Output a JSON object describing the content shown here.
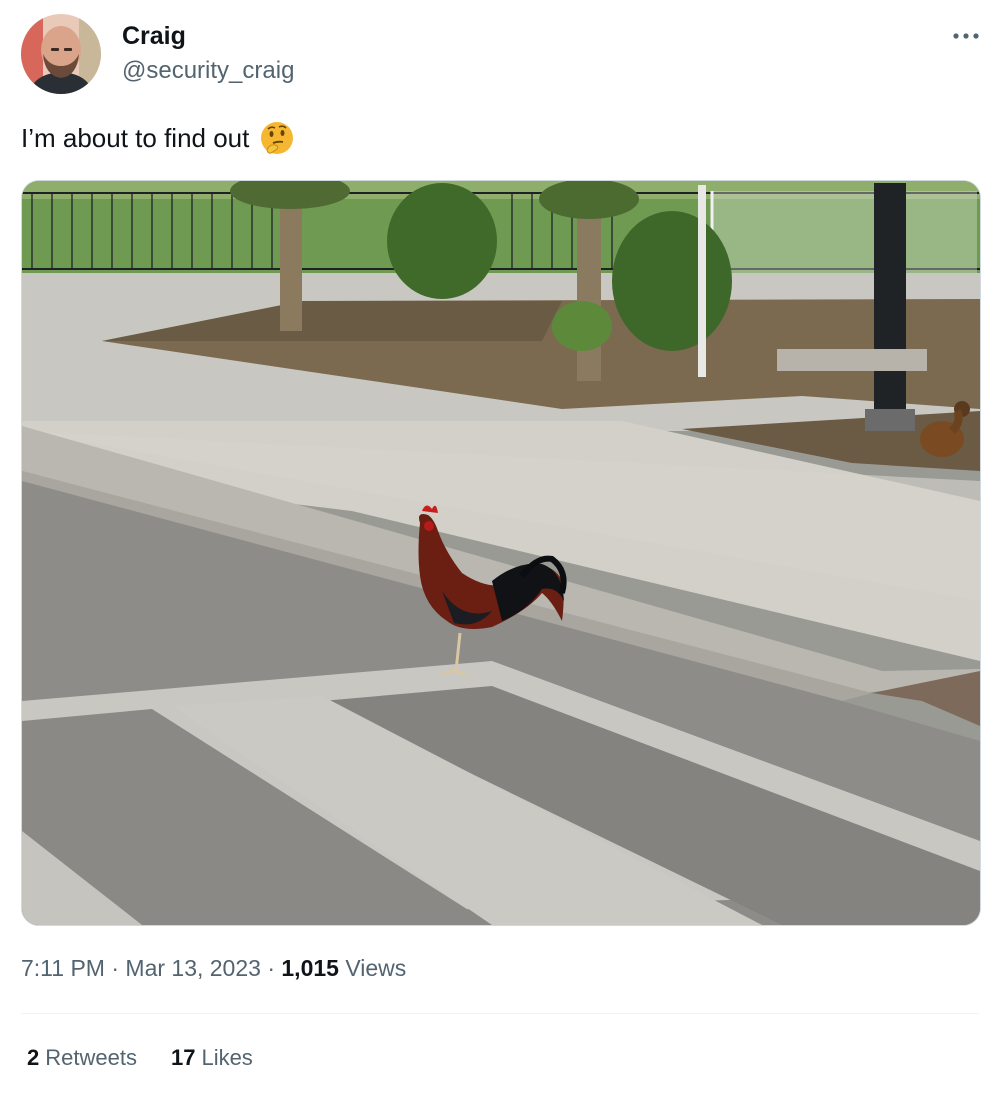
{
  "author": {
    "name": "Craig",
    "handle": "@security_craig"
  },
  "tweet": {
    "text": "I’m about to find out",
    "emoji": "thinking-face"
  },
  "meta": {
    "time": "7:11 PM",
    "separator": "·",
    "date": "Mar 13, 2023",
    "views_count": "1,015",
    "views_label": "Views"
  },
  "stats": {
    "retweets_count": "2",
    "retweets_label": "Retweets",
    "likes_count": "17",
    "likes_label": "Likes"
  },
  "colors": {
    "text": "#0f1419",
    "secondary": "#536471",
    "border": "#cfd9de"
  }
}
